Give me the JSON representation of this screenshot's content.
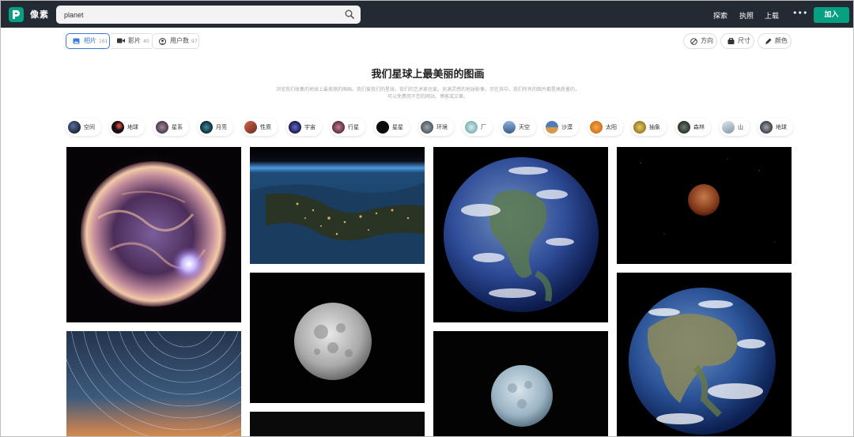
{
  "header": {
    "logo_text": "像素",
    "search": {
      "value": "planet",
      "placeholder": ""
    },
    "nav": [
      "探索",
      "执照",
      "上载"
    ],
    "more_label": "•••",
    "join_label": "加入"
  },
  "tabs": [
    {
      "label": "相片",
      "count": "161",
      "icon": "image-icon",
      "active": true
    },
    {
      "label": "影片",
      "count": "40",
      "icon": "video-icon",
      "active": false
    },
    {
      "label": "用户数",
      "count": "97",
      "icon": "user-icon",
      "active": false
    }
  ],
  "filters": [
    {
      "label": "方向",
      "icon": "orientation-icon"
    },
    {
      "label": "尺寸",
      "icon": "size-icon"
    },
    {
      "label": "颜色",
      "icon": "color-icon"
    }
  ],
  "page": {
    "title": "我们星球上最美丽的图画",
    "description_line1": "浏览我们收集的地球上最美丽的图画。我们爱我们的星球，我们的艺术家也爱。充满灵感的地球影像，尽在其中。我们所有的图片都是高质量的，",
    "description_line2": "可以免费用于您的网站、博客或文章。"
  },
  "chips": [
    {
      "label": "空间",
      "color": "#1b2538"
    },
    {
      "label": "地球",
      "color": "#1a0f14"
    },
    {
      "label": "星系",
      "color": "#4a3a4c"
    },
    {
      "label": "月亮",
      "color": "#0d2630"
    },
    {
      "label": "性质",
      "color": "#8a3a24"
    },
    {
      "label": "宇宙",
      "color": "#1c1748"
    },
    {
      "label": "行星",
      "color": "#5a2d40"
    },
    {
      "label": "星星",
      "color": "#0c0c0e"
    },
    {
      "label": "环境",
      "color": "#4f5a60"
    },
    {
      "label": "厂",
      "color": "#9fc7c4"
    },
    {
      "label": "天空",
      "color": "#5a80b0"
    },
    {
      "label": "沙漠",
      "color": "#d89a4a"
    },
    {
      "label": "太阳",
      "color": "#d2711c"
    },
    {
      "label": "抽象",
      "color": "#c6a33a"
    },
    {
      "label": "森林",
      "color": "#3f4a3e"
    },
    {
      "label": "山",
      "color": "#a3b7c5"
    },
    {
      "label": "地球",
      "color": "#555a63"
    }
  ],
  "photos": [
    {
      "name": "photo-sun"
    },
    {
      "name": "photo-earth-city-lights"
    },
    {
      "name": "photo-earth-americas"
    },
    {
      "name": "photo-red-moon"
    },
    {
      "name": "photo-star-trails"
    },
    {
      "name": "photo-full-moon"
    },
    {
      "name": "photo-blue-moon"
    },
    {
      "name": "photo-earth-blue-marble"
    },
    {
      "name": "photo-partial"
    }
  ]
}
